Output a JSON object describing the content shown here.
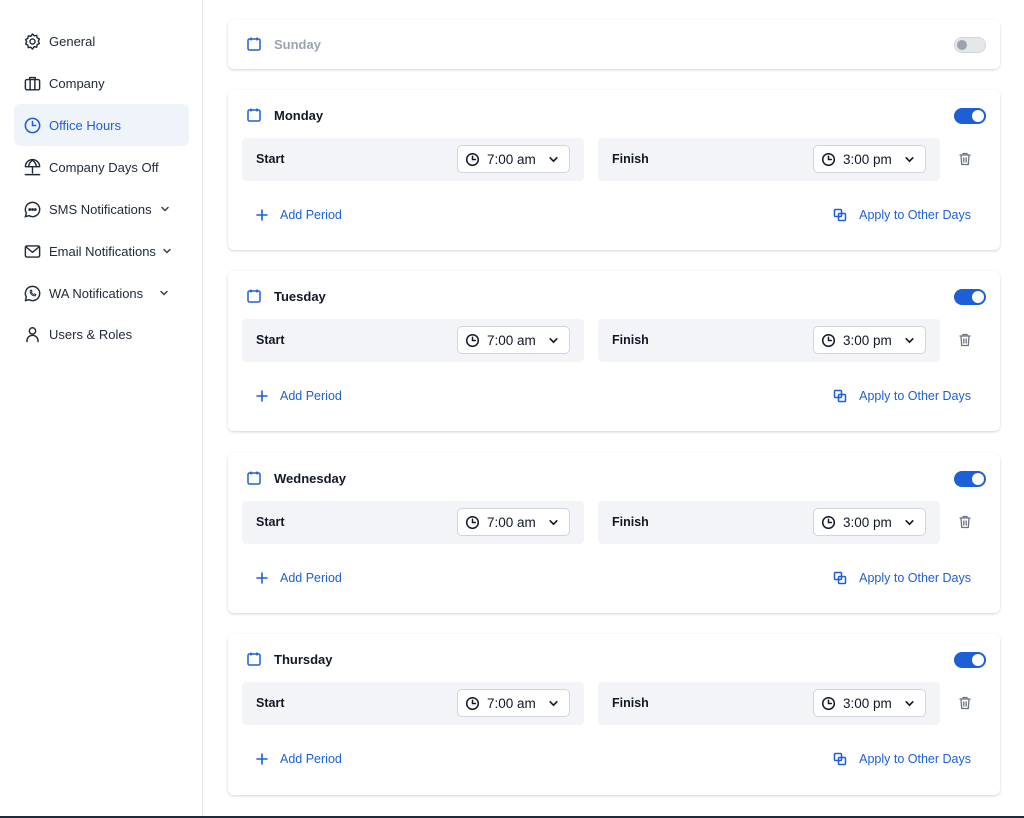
{
  "sidebar": {
    "items": [
      {
        "label": "General",
        "icon": "gear-icon",
        "active": false,
        "has_chevron": false
      },
      {
        "label": "Company",
        "icon": "briefcase-icon",
        "active": false,
        "has_chevron": false
      },
      {
        "label": "Office Hours",
        "icon": "clock-icon",
        "active": true,
        "has_chevron": false
      },
      {
        "label": "Company Days Off",
        "icon": "beach-umbrella-icon",
        "active": false,
        "has_chevron": false
      },
      {
        "label": "SMS Notifications",
        "icon": "chat-bubble-icon",
        "active": false,
        "has_chevron": true
      },
      {
        "label": "Email Notifications",
        "icon": "envelope-icon",
        "active": false,
        "has_chevron": true
      },
      {
        "label": "WA Notifications",
        "icon": "whatsapp-icon",
        "active": false,
        "has_chevron": true
      },
      {
        "label": "Users & Roles",
        "icon": "user-icon",
        "active": false,
        "has_chevron": false
      }
    ]
  },
  "days": [
    {
      "name": "Sunday",
      "enabled": false
    },
    {
      "name": "Monday",
      "enabled": true,
      "start_label": "Start",
      "start": "7:00 am",
      "finish_label": "Finish",
      "finish": "3:00 pm",
      "add_period": "Add Period",
      "apply_label": "Apply to Other Days"
    },
    {
      "name": "Tuesday",
      "enabled": true,
      "start_label": "Start",
      "start": "7:00 am",
      "finish_label": "Finish",
      "finish": "3:00 pm",
      "add_period": "Add Period",
      "apply_label": "Apply to Other Days"
    },
    {
      "name": "Wednesday",
      "enabled": true,
      "start_label": "Start",
      "start": "7:00 am",
      "finish_label": "Finish",
      "finish": "3:00 pm",
      "add_period": "Add Period",
      "apply_label": "Apply to Other Days"
    },
    {
      "name": "Thursday",
      "enabled": true,
      "start_label": "Start",
      "start": "7:00 am",
      "finish_label": "Finish",
      "finish": "3:00 pm",
      "add_period": "Add Period",
      "apply_label": "Apply to Other Days"
    }
  ],
  "colors": {
    "accent": "#1d5fd6",
    "active_bg": "#eff4fb",
    "row_bg": "#f3f4f7"
  }
}
